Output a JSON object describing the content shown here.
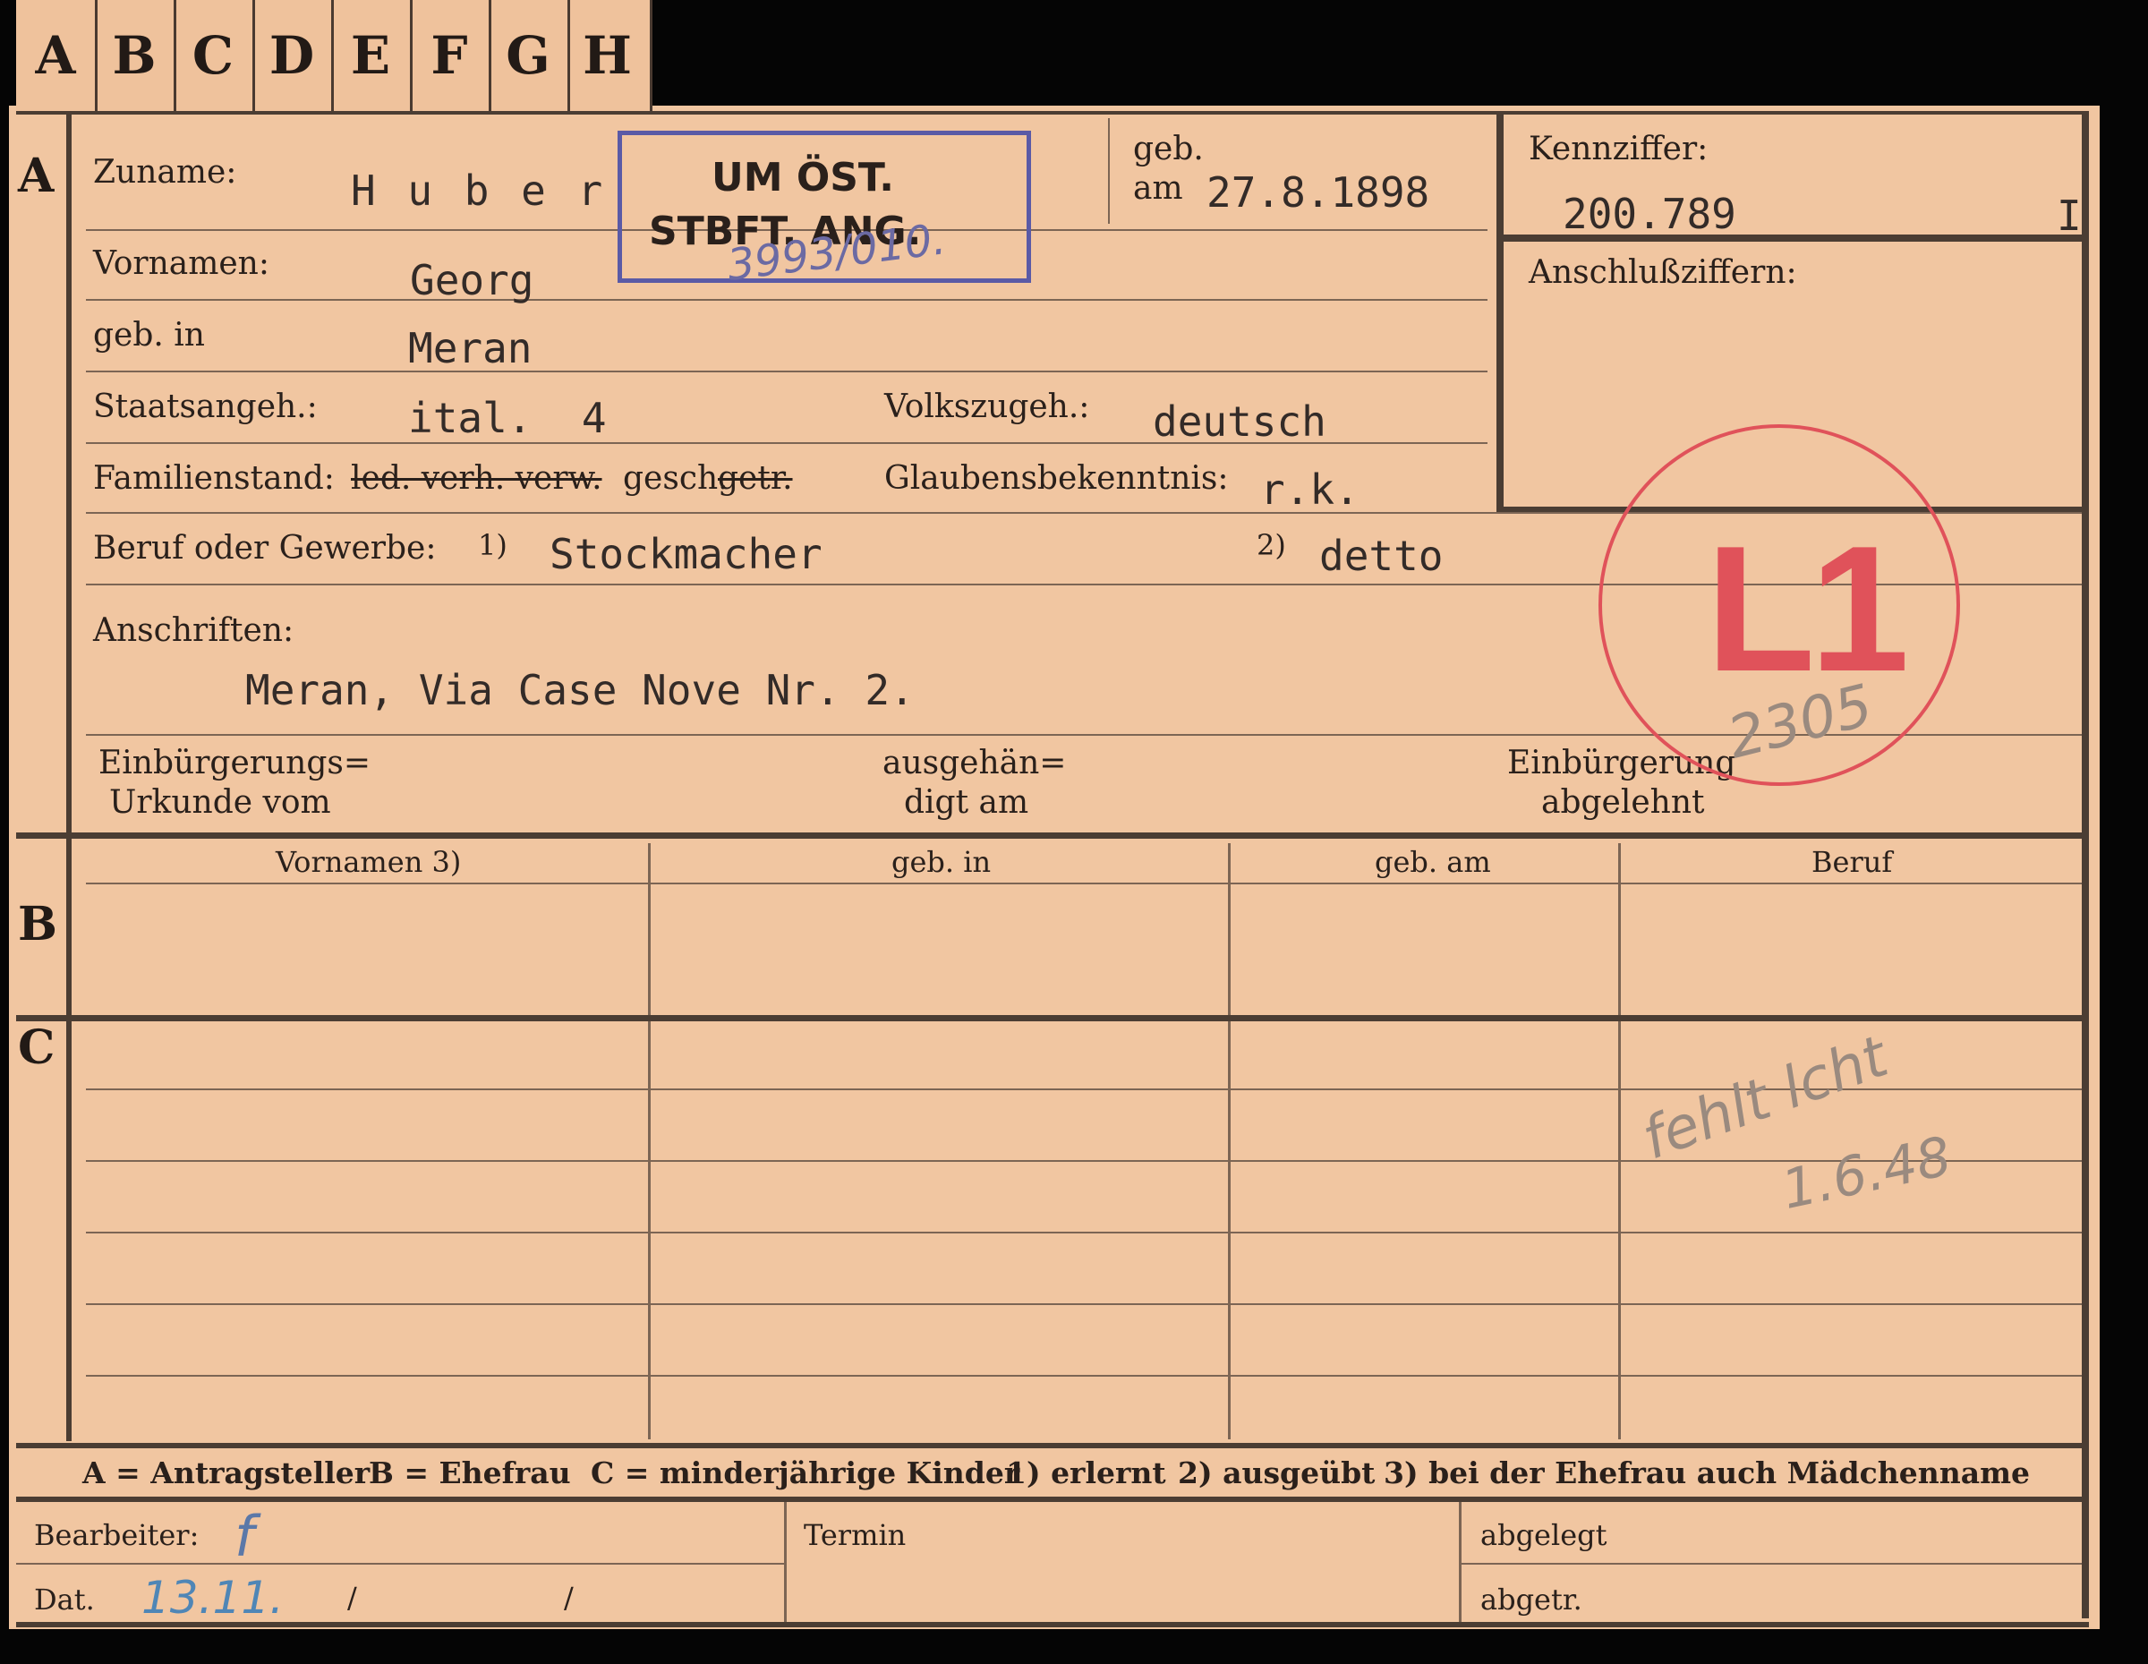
{
  "tabs": [
    "A",
    "B",
    "C",
    "D",
    "E",
    "F",
    "G",
    "H"
  ],
  "sections": {
    "a": "A",
    "b": "B",
    "c": "C"
  },
  "section_a": {
    "zuname_label": "Zuname:",
    "zuname_value": "H u b e r",
    "geb_label": "geb.",
    "am_label": "am",
    "geb_am_value": "27.8.1898",
    "kennziffer_label": "Kennziffer:",
    "kennziffer_value": "200.789",
    "kennziffer_suffix": "I",
    "anschluss_label": "Anschlußziffern:",
    "vornamen_label": "Vornamen:",
    "vornamen_value": "Georg",
    "geb_in_label": "geb. in",
    "geb_in_value": "Meran",
    "staatsangeh_label": "Staatsangeh.:",
    "staatsangeh_value": "ital.  4",
    "volkszugeh_label": "Volkszugeh.:",
    "volkszugeh_value": "deutsch",
    "familienstand_label": "Familienstand:",
    "familienstand_struck": "led. verh. verw.",
    "familienstand_gesch": "gesch.",
    "familienstand_getr": "getr.",
    "glauben_label": "Glaubensbekenntnis:",
    "glauben_value": "r.k.",
    "beruf_label": "Beruf oder Gewerbe:",
    "beruf_mark1": "1)",
    "beruf_value1": "Stockmacher",
    "beruf_mark2": "2)",
    "beruf_value2": "detto",
    "anschriften_label": "Anschriften:",
    "anschriften_value": "Meran, Via Case Nove Nr. 2.",
    "einb_urkunde_line1": "Einbürgerungs=",
    "einb_urkunde_line2": "Urkunde vom",
    "ausgehaendigt_line1": "ausgehän=",
    "ausgehaendigt_line2": "digt am",
    "einb_abgelehnt_line1": "Einbürgerung",
    "einb_abgelehnt_line2": "abgelehnt"
  },
  "stamps": {
    "box_line1": "UM ÖST.",
    "box_line2": "STBFT. ANG.",
    "box_hand": "3993/010.",
    "circle_text": "L1",
    "circle_hand": "2305"
  },
  "section_b": {
    "columns": [
      "Vornamen 3)",
      "geb. in",
      "geb. am",
      "Beruf"
    ]
  },
  "section_c": {
    "note_line1": "fehlt lcht",
    "note_line2": "1.6.48"
  },
  "legend": {
    "a": "A = Antragsteller",
    "b": "B = Ehefrau",
    "c": "C = minderjährige Kinder",
    "n1": "1) erlernt",
    "n2": "2) ausgeübt",
    "n3": "3) bei der Ehefrau auch Mädchenname"
  },
  "footer": {
    "bearbeiter_label": "Bearbeiter:",
    "bearbeiter_value": "f",
    "dat_label": "Dat.",
    "dat_value": "13.11.",
    "dat_sep1": "/",
    "dat_sep2": "/",
    "termin_label": "Termin",
    "abgelegt_label": "abgelegt",
    "abgetr_label": "abgetr."
  }
}
